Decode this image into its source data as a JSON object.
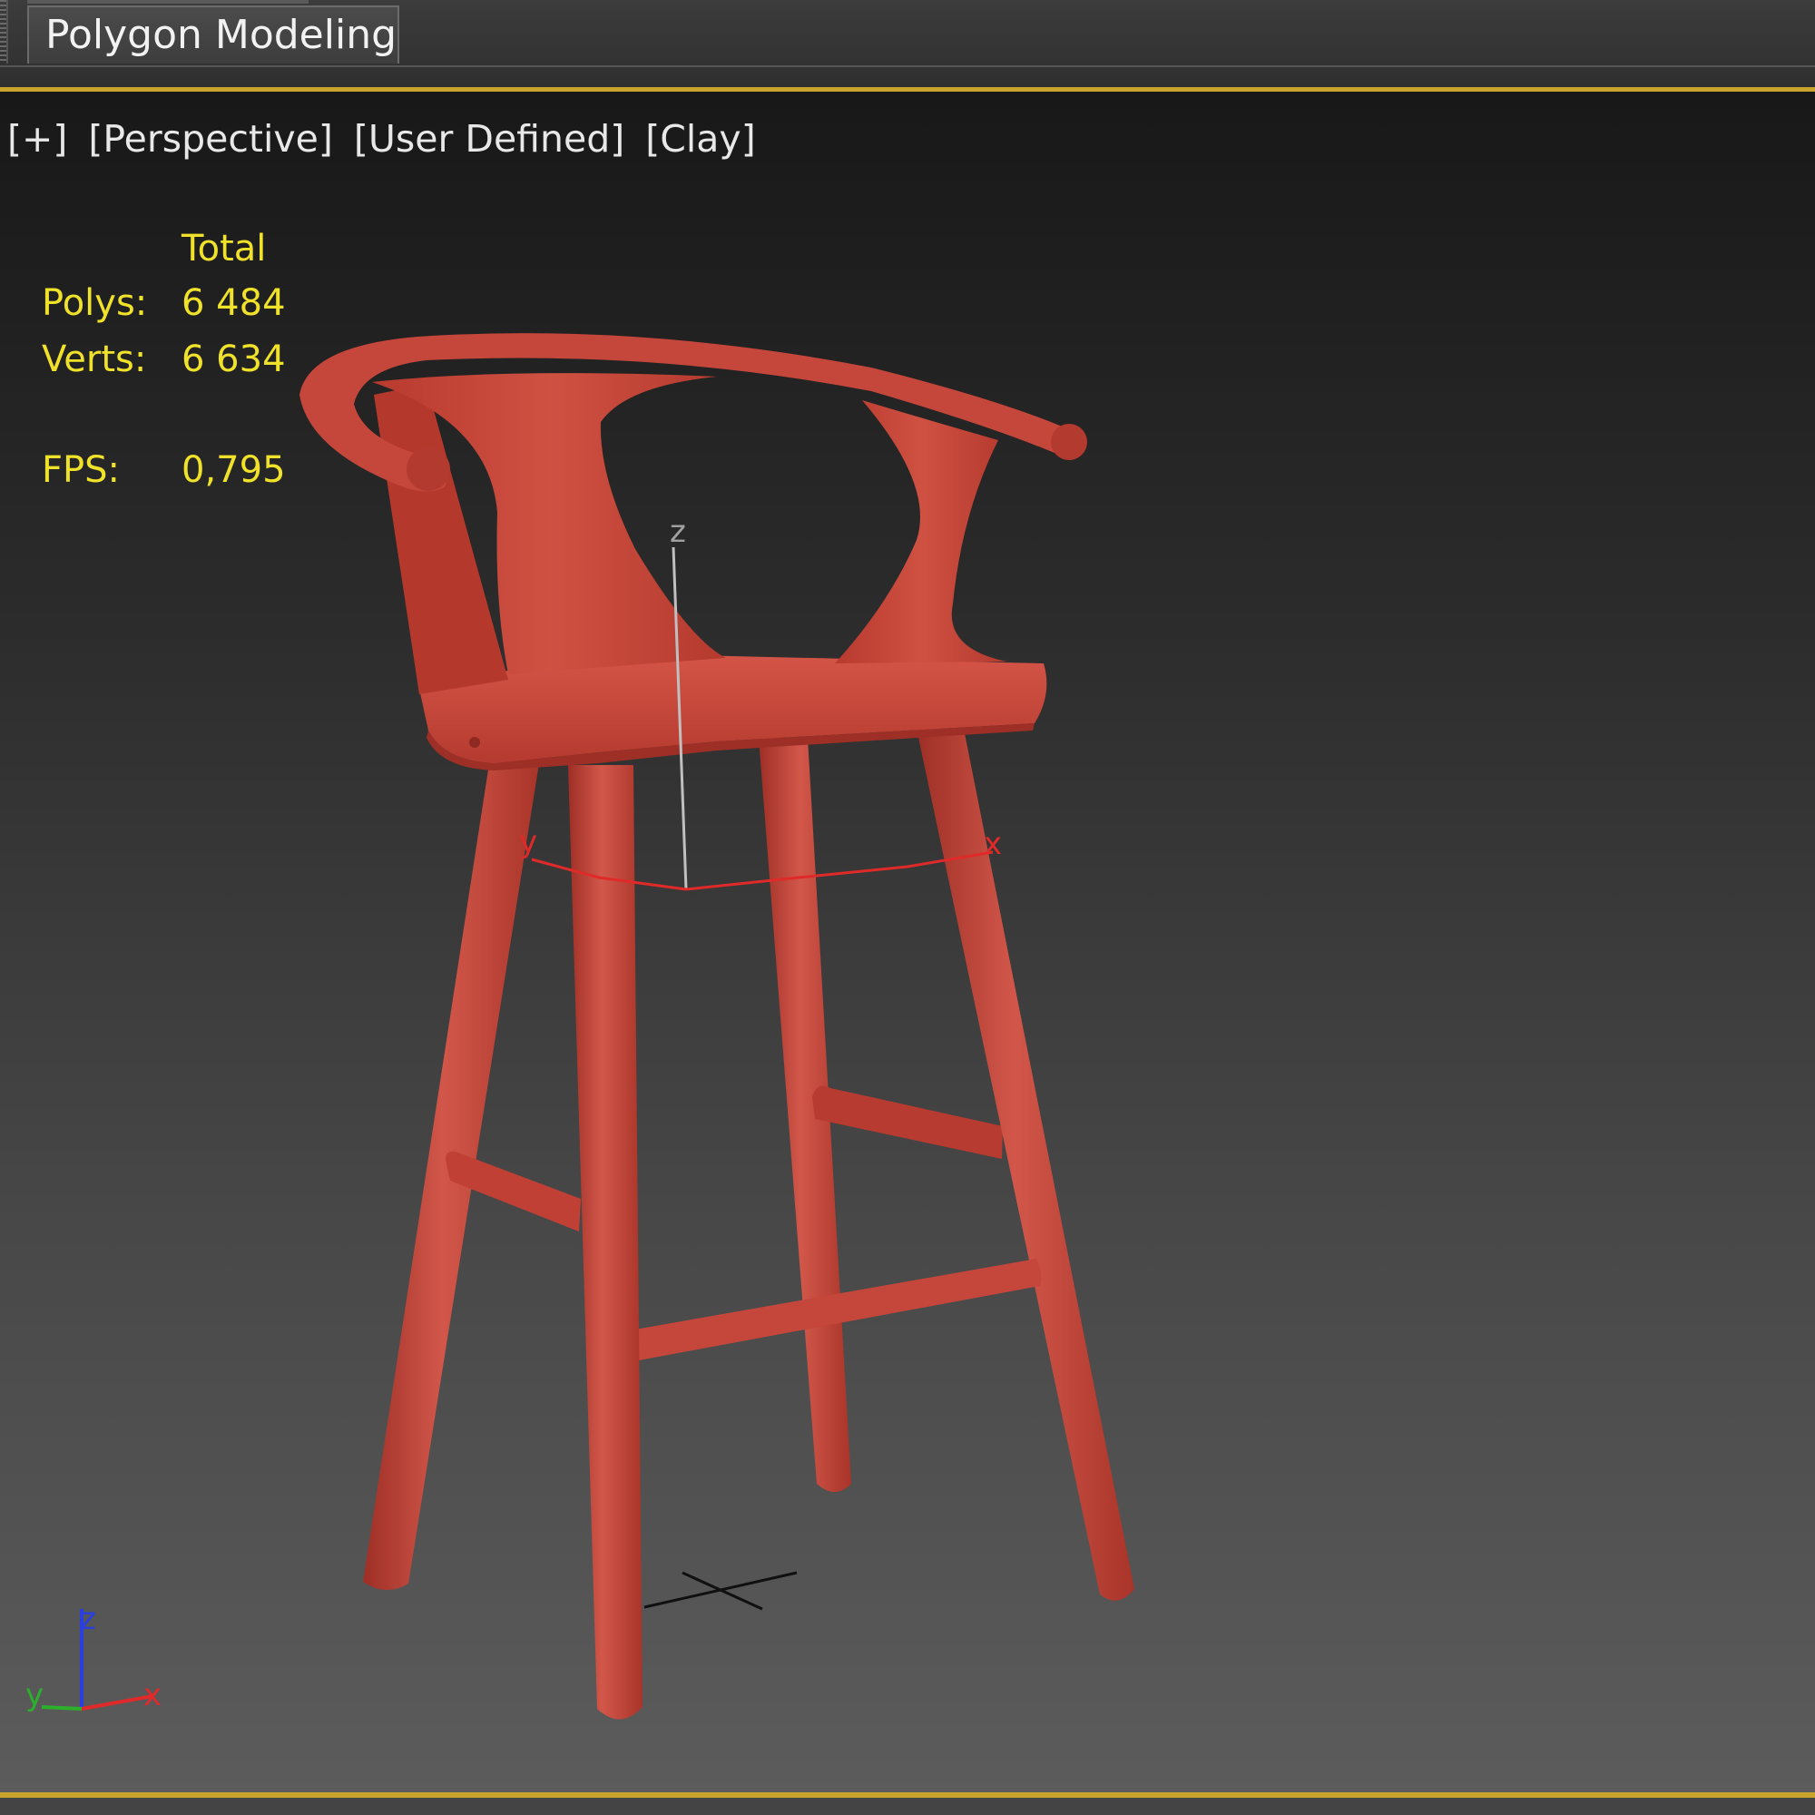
{
  "ribbon": {
    "tab_label": "Polygon Modeling"
  },
  "viewport": {
    "labels": [
      "[+]",
      "[Perspective]",
      "[User Defined]",
      "[Clay]"
    ],
    "stats": {
      "header": "Total",
      "polys_label": "Polys:",
      "polys_value": "6 484",
      "verts_label": "Verts:",
      "verts_value": "6 634",
      "fps_label": "FPS:",
      "fps_value": "0,795"
    },
    "gizmo_axes": {
      "z": "z",
      "y": "y",
      "x": "x"
    },
    "view_axes": {
      "z": "z",
      "y": "y",
      "x": "x"
    }
  },
  "colors": {
    "accent_border": "#c9a32b",
    "stats_text": "#f0e12a",
    "model": "#c9473b",
    "axis_x": "#e02a2a",
    "axis_y": "#2cb02c",
    "axis_z": "#2a3fe0"
  },
  "icons": [
    "view-axis-tripod-icon",
    "transform-gizmo-icon",
    "grid-origin-icon"
  ]
}
